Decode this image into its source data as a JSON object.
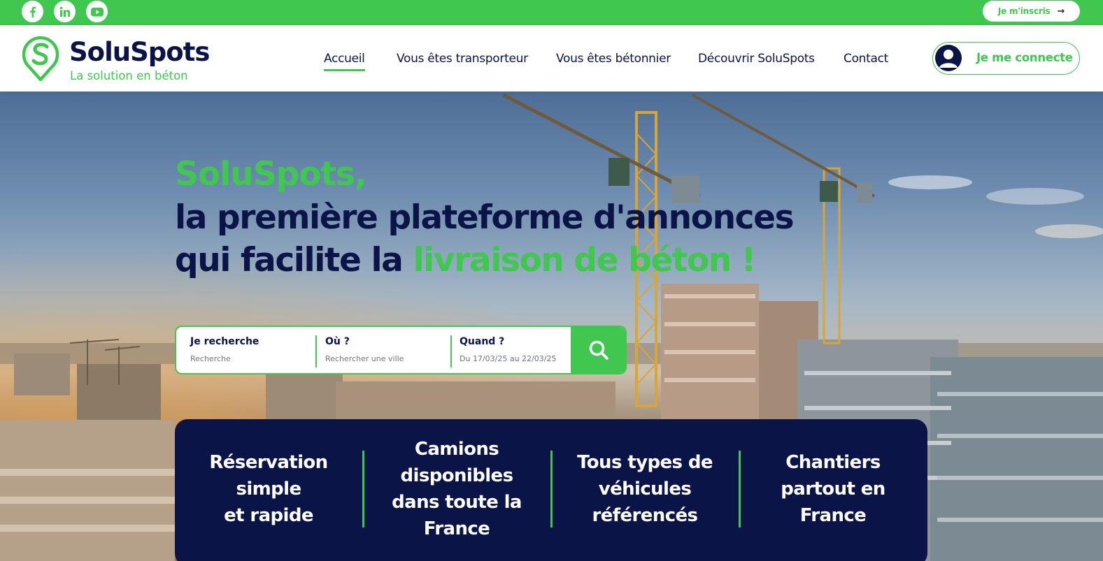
{
  "topbar": {
    "social": [
      {
        "name": "facebook",
        "icon": "facebook-icon"
      },
      {
        "name": "linkedin",
        "icon": "linkedin-icon"
      },
      {
        "name": "youtube",
        "icon": "youtube-icon"
      }
    ],
    "signup_label": "Je m'inscris",
    "signup_arrow": "→"
  },
  "brand": {
    "name": "SoluSpots",
    "tagline": "La solution en béton",
    "color_green": "#3fc74f",
    "color_navy": "#0b1446"
  },
  "nav": {
    "items": [
      {
        "label": "Accueil",
        "active": true
      },
      {
        "label": "Vous êtes transporteur",
        "active": false
      },
      {
        "label": "Vous êtes bétonnier",
        "active": false
      },
      {
        "label": "Découvrir SoluSpots",
        "active": false
      },
      {
        "label": "Contact",
        "active": false
      }
    ],
    "login_label": "Je me connecte"
  },
  "hero": {
    "line1": "SoluSpots,",
    "line2": "la première plateforme d'annonces",
    "line3_prefix": "qui facilite la ",
    "line3_accent": "livraison de béton !"
  },
  "search": {
    "what": {
      "label": "Je recherche",
      "placeholder": "Recherche"
    },
    "where": {
      "label": "Où ?",
      "placeholder": "Rechercher une ville"
    },
    "when": {
      "label": "Quand ?",
      "value": "Du 17/03/25 au 22/03/25"
    },
    "button_icon": "search-icon"
  },
  "features": [
    "Réservation\nsimple\net rapide",
    "Camions\ndisponibles\ndans toute la\nFrance",
    "Tous types de\nvéhicules\nréférencés",
    "Chantiers\npartout en\nFrance"
  ]
}
